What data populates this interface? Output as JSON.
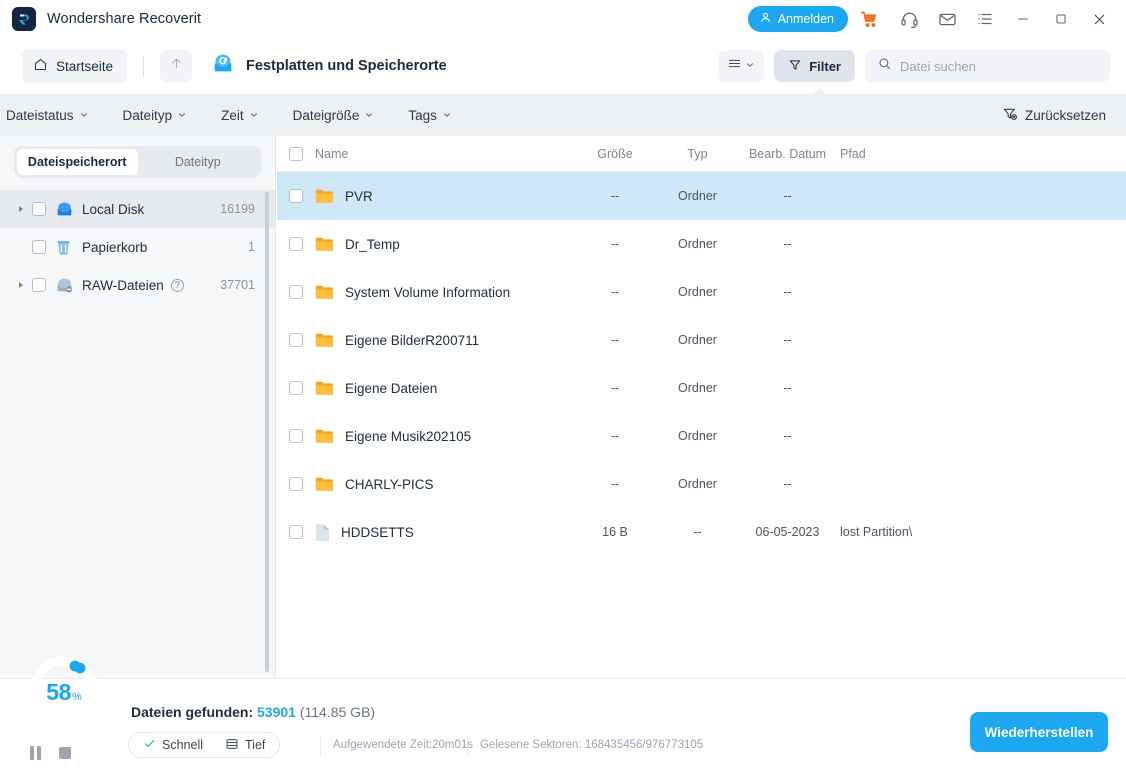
{
  "window": {
    "title": "Wondershare Recoverit",
    "logo_icon": "recoverit-logo-icon",
    "signin_label": "Anmelden",
    "icons": {
      "user": "user-icon",
      "cart": "shopping-cart-icon",
      "support": "headset-icon",
      "mail": "mail-icon",
      "menu": "list-menu-icon",
      "minimize": "minimize-icon",
      "maximize": "maximize-icon",
      "close": "close-icon"
    }
  },
  "toolbar": {
    "home_label": "Startseite",
    "home_icon": "home-icon",
    "up_icon": "arrow-up-icon",
    "breadcrumb_icon": "disk-scan-icon",
    "breadcrumb_label": "Festplatten und Speicherorte",
    "view_icon": "list-view-icon",
    "view_caret": "chevron-down-icon",
    "filter_label": "Filter",
    "filter_icon": "funnel-icon",
    "search_icon": "search-icon",
    "search_placeholder": "Datei suchen",
    "search_value": ""
  },
  "filterbar": {
    "dropdowns": [
      {
        "label": "Dateistatus",
        "caret": "chevron-down-icon"
      },
      {
        "label": "Dateityp",
        "caret": "chevron-down-icon"
      },
      {
        "label": "Zeit",
        "caret": "chevron-down-icon"
      },
      {
        "label": "Dateigröße",
        "caret": "chevron-down-icon"
      },
      {
        "label": "Tags",
        "caret": "chevron-down-icon"
      }
    ],
    "reset_label": "Zurücksetzen",
    "reset_icon": "funnel-reset-icon"
  },
  "sidebar": {
    "tabs": [
      {
        "label": "Dateispeicherort",
        "active": true
      },
      {
        "label": "Dateityp",
        "active": false
      }
    ],
    "tree": [
      {
        "label": "Local Disk",
        "count": "16199",
        "icon": "hard-disk-icon",
        "expandable": true,
        "selected": true,
        "help": false
      },
      {
        "label": "Papierkorb",
        "count": "1",
        "icon": "recycle-bin-icon",
        "expandable": false,
        "selected": false,
        "help": false
      },
      {
        "label": "RAW-Dateien",
        "count": "37701",
        "icon": "raw-files-icon",
        "expandable": true,
        "selected": false,
        "help": true
      }
    ]
  },
  "filelist": {
    "columns": [
      "Name",
      "Größe",
      "Typ",
      "Bearb. Datum",
      "Pfad"
    ],
    "rows": [
      {
        "name": "PVR",
        "size": "--",
        "type": "Ordner",
        "date": "--",
        "path": "",
        "icon": "folder-icon",
        "selected": true
      },
      {
        "name": "Dr_Temp",
        "size": "--",
        "type": "Ordner",
        "date": "--",
        "path": "",
        "icon": "folder-icon",
        "selected": false
      },
      {
        "name": "System Volume Information",
        "size": "--",
        "type": "Ordner",
        "date": "--",
        "path": "",
        "icon": "folder-icon",
        "selected": false
      },
      {
        "name": "Eigene BilderR200711",
        "size": "--",
        "type": "Ordner",
        "date": "--",
        "path": "",
        "icon": "folder-icon",
        "selected": false
      },
      {
        "name": "Eigene Dateien",
        "size": "--",
        "type": "Ordner",
        "date": "--",
        "path": "",
        "icon": "folder-icon",
        "selected": false
      },
      {
        "name": "Eigene Musik202105",
        "size": "--",
        "type": "Ordner",
        "date": "--",
        "path": "",
        "icon": "folder-icon",
        "selected": false
      },
      {
        "name": "CHARLY-PICS",
        "size": "--",
        "type": "Ordner",
        "date": "--",
        "path": "",
        "icon": "folder-icon",
        "selected": false
      },
      {
        "name": "HDDSETTS",
        "size": "16 B",
        "type": "--",
        "date": "06-05-2023",
        "path": "lost Partition\\",
        "icon": "file-icon",
        "selected": false
      }
    ]
  },
  "status": {
    "progress_percent": "58",
    "progress_symbol": "%",
    "progress_value": 58,
    "pause_icon": "pause-icon",
    "stop_icon": "stop-icon",
    "found_label": "Dateien gefunden:",
    "found_count": "53901",
    "found_size": "(114.85 GB)",
    "mode_quick": "Schnell",
    "mode_quick_icon": "check-icon",
    "mode_deep": "Tief",
    "mode_deep_icon": "deep-scan-icon",
    "elapsed": "Aufgewendete Zeit:20m01s",
    "sectors": "Gelesene Sektoren: 168435456/976773105",
    "recover_label": "Wiederherstellen"
  },
  "colors": {
    "accent": "#1ca7f0",
    "row_selected": "#cfe8f7",
    "folder": "#f6a623",
    "cart": "#f56b1f",
    "check_green": "#2fc48d",
    "filterbar_bg": "#eef1f4",
    "sidebar_bg": "#f5f7f9"
  }
}
